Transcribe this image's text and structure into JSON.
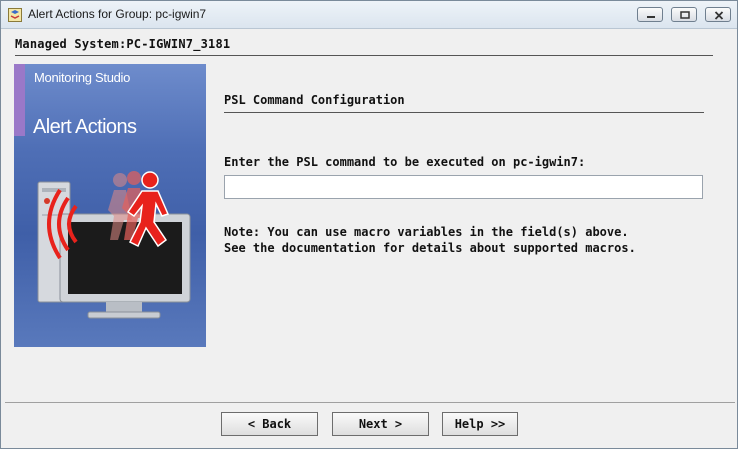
{
  "window": {
    "title": "Alert Actions for Group: pc-igwin7",
    "app_icon": "pc-app-icon",
    "controls": [
      "minimize-icon",
      "maximize-icon",
      "close-icon"
    ]
  },
  "header": {
    "managed_system": "Managed System:PC-IGWIN7_3181"
  },
  "banner": {
    "brand": "Monitoring Studio",
    "heading": "Alert Actions",
    "illustration": "alert-person-monitor-illustration"
  },
  "main": {
    "section_title": "PSL Command Configuration",
    "prompt": "Enter the PSL command to be executed on pc-igwin7:",
    "command_value": "",
    "note_line1": "Note: You can use macro variables in the field(s) above.",
    "note_line2": "See the documentation for details about supported macros."
  },
  "buttons": {
    "back": "< Back",
    "next": "Next >",
    "help": "Help >>"
  },
  "colors": {
    "banner_blue": "#4f6fb6",
    "banner_strip": "#9a78c8",
    "alert_red": "#e8221c"
  }
}
